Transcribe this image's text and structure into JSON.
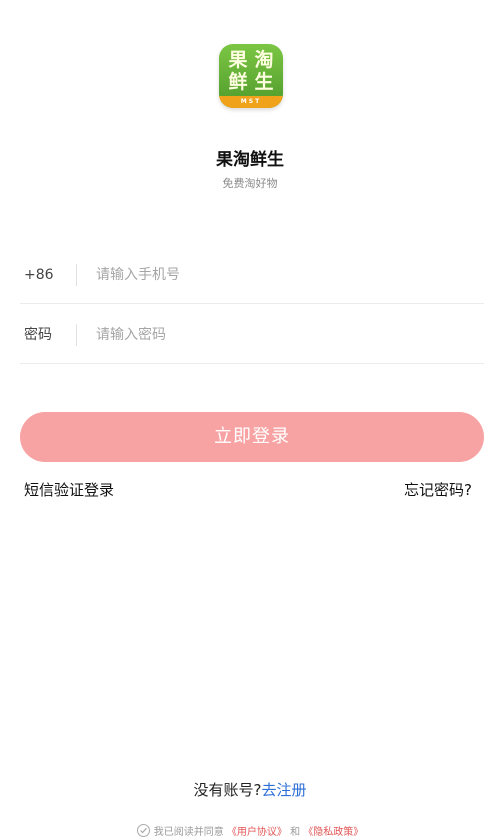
{
  "app": {
    "logo_chars": [
      "果",
      "淘",
      "鲜",
      "生"
    ],
    "logo_band_text": "MST",
    "name": "果淘鲜生",
    "slogan": "免费淘好物"
  },
  "form": {
    "phone": {
      "prefix": "+86",
      "placeholder": "请输入手机号",
      "value": ""
    },
    "password": {
      "label": "密码",
      "placeholder": "请输入密码",
      "value": ""
    }
  },
  "actions": {
    "login_label": "立即登录",
    "sms_login_label": "短信验证登录",
    "forgot_password_label": "忘记密码?"
  },
  "register": {
    "question": "没有账号?",
    "link_label": "去注册"
  },
  "agreement": {
    "prefix": "我已阅读并同意",
    "user_agreement": "《用户协议》",
    "conjunction": "和",
    "privacy_policy": "《隐私政策》"
  },
  "colors": {
    "brand_green": "#5aa832",
    "login_button": "#f8a3a3",
    "link_blue": "#2d6fd8",
    "policy_red": "#e25555"
  },
  "icons": {
    "agreement_checkbox": "check-circle-icon"
  }
}
